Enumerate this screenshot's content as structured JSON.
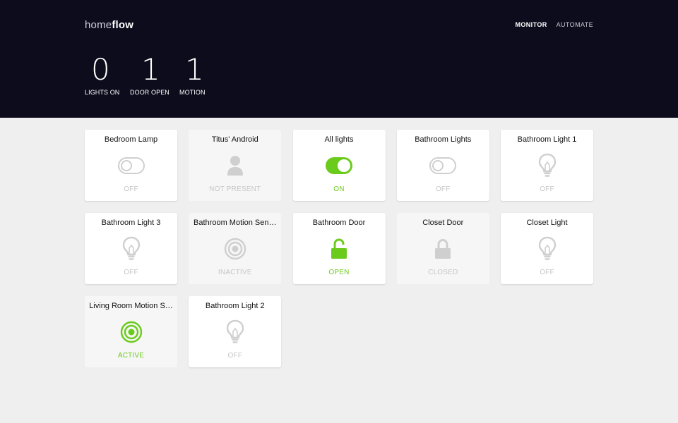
{
  "app": {
    "logo_light": "home",
    "logo_bold": "flow"
  },
  "nav": [
    {
      "label": "MONITOR",
      "active": true
    },
    {
      "label": "AUTOMATE",
      "active": false
    }
  ],
  "stats": [
    {
      "value": "0",
      "label": "LIGHTS ON"
    },
    {
      "value": "1",
      "label": "DOOR OPEN"
    },
    {
      "value": "1",
      "label": "MOTION"
    }
  ],
  "colors": {
    "accent": "#6bcb1c",
    "inactive": "#cfcfcf",
    "header_bg": "#0c0c1d"
  },
  "tiles": [
    {
      "title": "Bedroom Lamp",
      "icon": "toggle-icon",
      "status": "OFF",
      "active": false,
      "muted": false
    },
    {
      "title": "Titus' Android",
      "icon": "person-icon",
      "status": "NOT PRESENT",
      "active": false,
      "muted": true
    },
    {
      "title": "All lights",
      "icon": "toggle-icon",
      "status": "ON",
      "active": true,
      "muted": false
    },
    {
      "title": "Bathroom Lights",
      "icon": "toggle-icon",
      "status": "OFF",
      "active": false,
      "muted": false
    },
    {
      "title": "Bathroom Light 1",
      "icon": "lightbulb-icon",
      "status": "OFF",
      "active": false,
      "muted": false
    },
    {
      "title": "Bathroom Light 3",
      "icon": "lightbulb-icon",
      "status": "OFF",
      "active": false,
      "muted": false
    },
    {
      "title": "Bathroom Motion Sen…",
      "icon": "motion-sensor-icon",
      "status": "INACTIVE",
      "active": false,
      "muted": true
    },
    {
      "title": "Bathroom Door",
      "icon": "unlock-icon",
      "status": "OPEN",
      "active": true,
      "muted": false
    },
    {
      "title": "Closet Door",
      "icon": "lock-icon",
      "status": "CLOSED",
      "active": false,
      "muted": true
    },
    {
      "title": "Closet Light",
      "icon": "lightbulb-icon",
      "status": "OFF",
      "active": false,
      "muted": false
    },
    {
      "title": "Living Room Motion S…",
      "icon": "motion-sensor-icon",
      "status": "ACTIVE",
      "active": true,
      "muted": true
    },
    {
      "title": "Bathroom Light 2",
      "icon": "lightbulb-icon",
      "status": "OFF",
      "active": false,
      "muted": false
    }
  ]
}
